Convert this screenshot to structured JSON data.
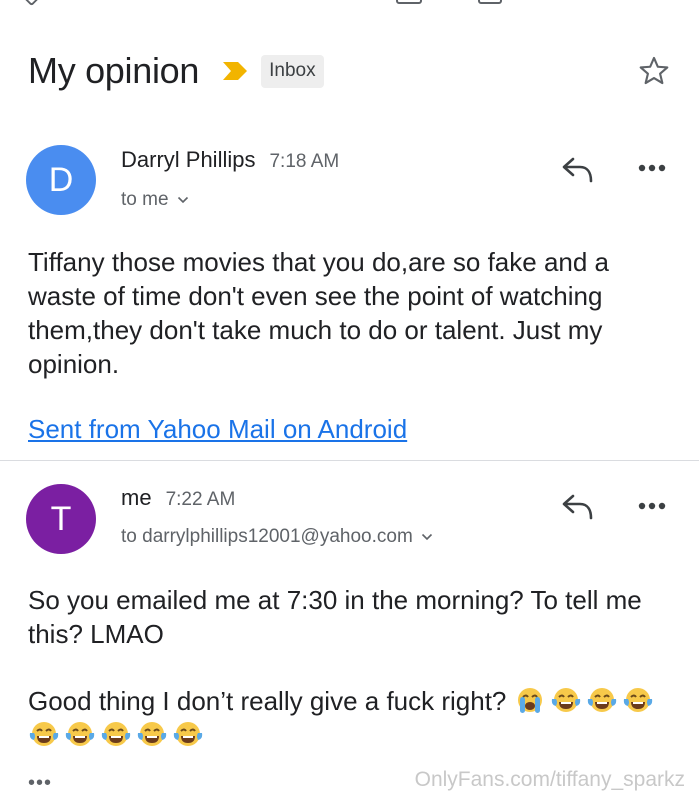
{
  "thread": {
    "subject": "My opinion",
    "label": "Inbox"
  },
  "messages": [
    {
      "avatar_letter": "D",
      "avatar_color": "#4a8df0",
      "sender": "Darryl Phillips",
      "time": "7:18 AM",
      "recipient": "to me",
      "body": "Tiffany those movies that you do,are so fake and a waste of time don't even see the point of watching them,they don't take much to do or talent. Just my opinion.",
      "signature_link": "Sent from Yahoo Mail on Android"
    },
    {
      "avatar_letter": "T",
      "avatar_color": "#7b1fa2",
      "sender": "me",
      "time": "7:22 AM",
      "recipient": "to darrylphillips12001@yahoo.com",
      "body_line1": "So you emailed me at 7:30 in the morning? To tell me this? LMAO",
      "body_line2": "Good thing I don’t really give a fuck right?"
    }
  ],
  "footer": {
    "trimmed_indicator": "•••",
    "watermark": "OnlyFans.com/tiffany_sparkz"
  },
  "colors": {
    "link": "#1a73e8",
    "importance_marker": "#f2b400",
    "secondary_text": "#5f6368"
  },
  "icons": [
    "important-marker-icon",
    "star-icon",
    "reply-icon",
    "more-options-icon",
    "chevron-down-icon",
    "loudly-crying-face-icon",
    "face-with-tears-of-joy-icon"
  ]
}
